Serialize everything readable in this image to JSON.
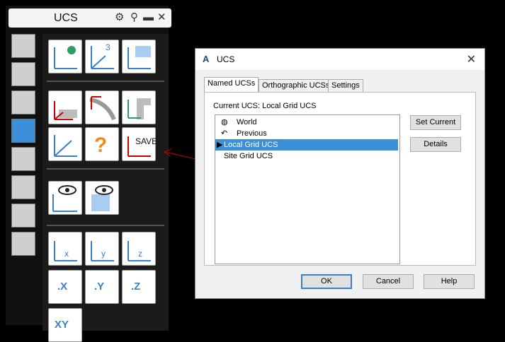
{
  "palette": {
    "title": "UCS",
    "save_label": "SAVE",
    "axis_x": ".X",
    "axis_y": ".Y",
    "axis_z": ".Z",
    "axis_xy": "XY",
    "view3d_label": "3"
  },
  "dialog": {
    "title": "UCS",
    "tabs": [
      "Named UCSs",
      "Orthographic UCSs",
      "Settings"
    ],
    "current_label": "Current UCS:  Local Grid UCS",
    "list": [
      "World",
      "Previous",
      "Local Grid UCS",
      "Site Grid UCS"
    ],
    "selected_index": 2,
    "buttons": {
      "set_current": "Set Current",
      "details": "Details",
      "ok": "OK",
      "cancel": "Cancel",
      "help": "Help"
    }
  },
  "colors": {
    "accent": "#3b8fd8",
    "annotation": "#cc0000"
  }
}
